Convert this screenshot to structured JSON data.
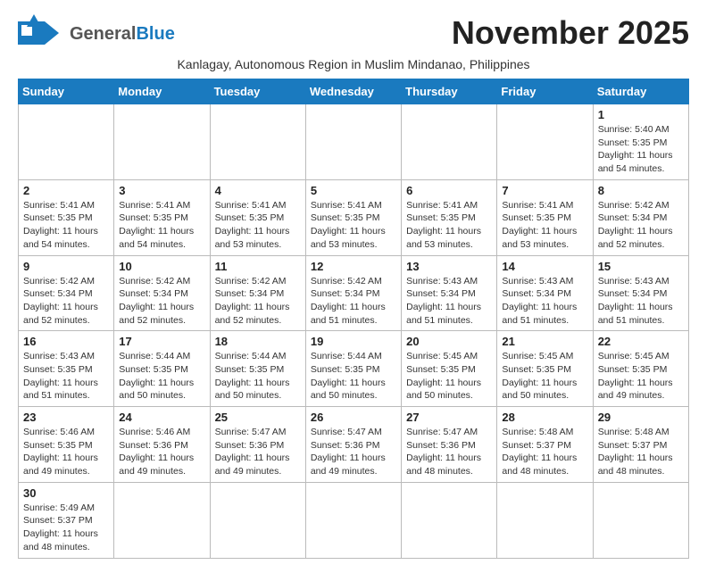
{
  "header": {
    "month_title": "November 2025",
    "subtitle": "Kanlagay, Autonomous Region in Muslim Mindanao, Philippines",
    "logo_general": "General",
    "logo_blue": "Blue"
  },
  "weekdays": [
    "Sunday",
    "Monday",
    "Tuesday",
    "Wednesday",
    "Thursday",
    "Friday",
    "Saturday"
  ],
  "weeks": [
    [
      {
        "day": "",
        "info": ""
      },
      {
        "day": "",
        "info": ""
      },
      {
        "day": "",
        "info": ""
      },
      {
        "day": "",
        "info": ""
      },
      {
        "day": "",
        "info": ""
      },
      {
        "day": "",
        "info": ""
      },
      {
        "day": "1",
        "info": "Sunrise: 5:40 AM\nSunset: 5:35 PM\nDaylight: 11 hours and 54 minutes."
      }
    ],
    [
      {
        "day": "2",
        "info": "Sunrise: 5:41 AM\nSunset: 5:35 PM\nDaylight: 11 hours and 54 minutes."
      },
      {
        "day": "3",
        "info": "Sunrise: 5:41 AM\nSunset: 5:35 PM\nDaylight: 11 hours and 54 minutes."
      },
      {
        "day": "4",
        "info": "Sunrise: 5:41 AM\nSunset: 5:35 PM\nDaylight: 11 hours and 53 minutes."
      },
      {
        "day": "5",
        "info": "Sunrise: 5:41 AM\nSunset: 5:35 PM\nDaylight: 11 hours and 53 minutes."
      },
      {
        "day": "6",
        "info": "Sunrise: 5:41 AM\nSunset: 5:35 PM\nDaylight: 11 hours and 53 minutes."
      },
      {
        "day": "7",
        "info": "Sunrise: 5:41 AM\nSunset: 5:35 PM\nDaylight: 11 hours and 53 minutes."
      },
      {
        "day": "8",
        "info": "Sunrise: 5:42 AM\nSunset: 5:34 PM\nDaylight: 11 hours and 52 minutes."
      }
    ],
    [
      {
        "day": "9",
        "info": "Sunrise: 5:42 AM\nSunset: 5:34 PM\nDaylight: 11 hours and 52 minutes."
      },
      {
        "day": "10",
        "info": "Sunrise: 5:42 AM\nSunset: 5:34 PM\nDaylight: 11 hours and 52 minutes."
      },
      {
        "day": "11",
        "info": "Sunrise: 5:42 AM\nSunset: 5:34 PM\nDaylight: 11 hours and 52 minutes."
      },
      {
        "day": "12",
        "info": "Sunrise: 5:42 AM\nSunset: 5:34 PM\nDaylight: 11 hours and 51 minutes."
      },
      {
        "day": "13",
        "info": "Sunrise: 5:43 AM\nSunset: 5:34 PM\nDaylight: 11 hours and 51 minutes."
      },
      {
        "day": "14",
        "info": "Sunrise: 5:43 AM\nSunset: 5:34 PM\nDaylight: 11 hours and 51 minutes."
      },
      {
        "day": "15",
        "info": "Sunrise: 5:43 AM\nSunset: 5:34 PM\nDaylight: 11 hours and 51 minutes."
      }
    ],
    [
      {
        "day": "16",
        "info": "Sunrise: 5:43 AM\nSunset: 5:35 PM\nDaylight: 11 hours and 51 minutes."
      },
      {
        "day": "17",
        "info": "Sunrise: 5:44 AM\nSunset: 5:35 PM\nDaylight: 11 hours and 50 minutes."
      },
      {
        "day": "18",
        "info": "Sunrise: 5:44 AM\nSunset: 5:35 PM\nDaylight: 11 hours and 50 minutes."
      },
      {
        "day": "19",
        "info": "Sunrise: 5:44 AM\nSunset: 5:35 PM\nDaylight: 11 hours and 50 minutes."
      },
      {
        "day": "20",
        "info": "Sunrise: 5:45 AM\nSunset: 5:35 PM\nDaylight: 11 hours and 50 minutes."
      },
      {
        "day": "21",
        "info": "Sunrise: 5:45 AM\nSunset: 5:35 PM\nDaylight: 11 hours and 50 minutes."
      },
      {
        "day": "22",
        "info": "Sunrise: 5:45 AM\nSunset: 5:35 PM\nDaylight: 11 hours and 49 minutes."
      }
    ],
    [
      {
        "day": "23",
        "info": "Sunrise: 5:46 AM\nSunset: 5:35 PM\nDaylight: 11 hours and 49 minutes."
      },
      {
        "day": "24",
        "info": "Sunrise: 5:46 AM\nSunset: 5:36 PM\nDaylight: 11 hours and 49 minutes."
      },
      {
        "day": "25",
        "info": "Sunrise: 5:47 AM\nSunset: 5:36 PM\nDaylight: 11 hours and 49 minutes."
      },
      {
        "day": "26",
        "info": "Sunrise: 5:47 AM\nSunset: 5:36 PM\nDaylight: 11 hours and 49 minutes."
      },
      {
        "day": "27",
        "info": "Sunrise: 5:47 AM\nSunset: 5:36 PM\nDaylight: 11 hours and 48 minutes."
      },
      {
        "day": "28",
        "info": "Sunrise: 5:48 AM\nSunset: 5:37 PM\nDaylight: 11 hours and 48 minutes."
      },
      {
        "day": "29",
        "info": "Sunrise: 5:48 AM\nSunset: 5:37 PM\nDaylight: 11 hours and 48 minutes."
      }
    ],
    [
      {
        "day": "30",
        "info": "Sunrise: 5:49 AM\nSunset: 5:37 PM\nDaylight: 11 hours and 48 minutes."
      },
      {
        "day": "",
        "info": ""
      },
      {
        "day": "",
        "info": ""
      },
      {
        "day": "",
        "info": ""
      },
      {
        "day": "",
        "info": ""
      },
      {
        "day": "",
        "info": ""
      },
      {
        "day": "",
        "info": ""
      }
    ]
  ]
}
